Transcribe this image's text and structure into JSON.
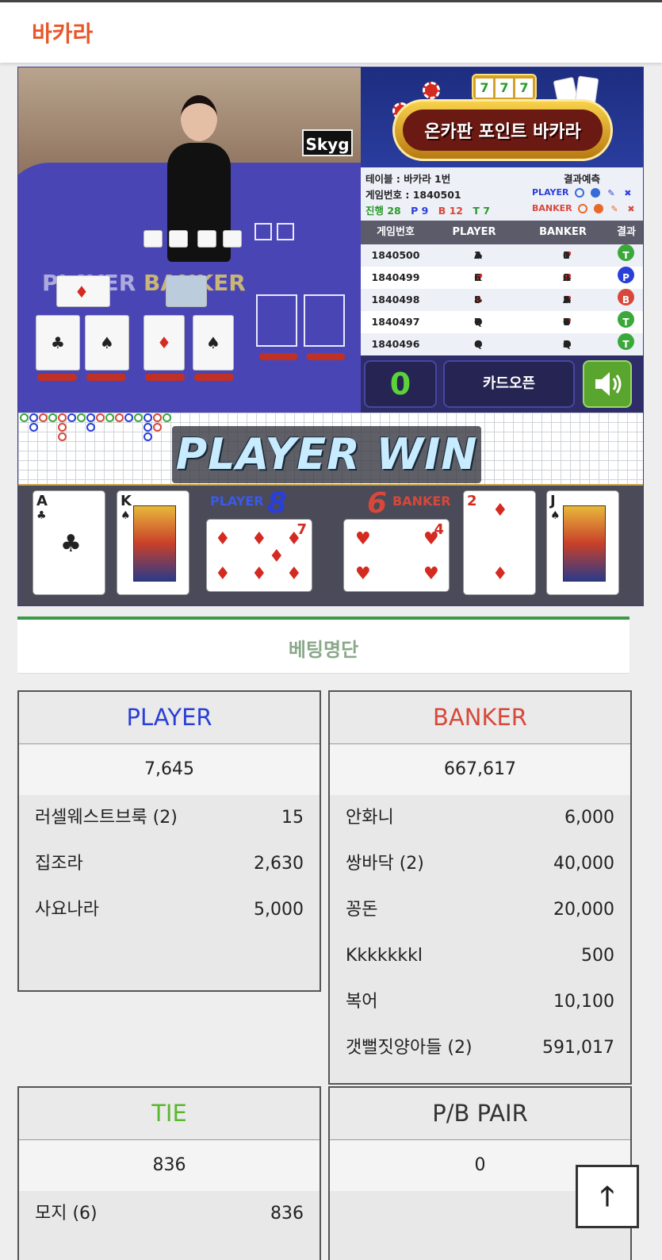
{
  "header": {
    "title": "바카라"
  },
  "game": {
    "video": {
      "felt_player": "PLAYER",
      "felt_banker": "BANKER",
      "sign": "Skyg"
    },
    "banner": {
      "title": "온카판 포인트 바카라",
      "reels": [
        "7",
        "7",
        "7"
      ]
    },
    "info": {
      "table": "테이블 : 바카라 1번",
      "game_no": "게임번호 : 1840501",
      "progress_label": "진행 28",
      "p_count": "P 9",
      "b_count": "B 12",
      "t_count": "T 7",
      "predict_title": "결과예측",
      "predict_player": "PLAYER",
      "predict_banker": "BANKER"
    },
    "history": {
      "headers": [
        "게임번호",
        "PLAYER",
        "BANKER",
        "결과"
      ],
      "rows": [
        {
          "no": "1840500",
          "player": "♣3♣A♠A",
          "banker": "♥5♥10",
          "result": "T"
        },
        {
          "no": "1840499",
          "player": "♥2♦K♥6",
          "banker": "♣10♣A♥9",
          "result": "P"
        },
        {
          "no": "1840498",
          "player": "♣5♦8♦8",
          "banker": "♥A♠A♣5",
          "result": "B"
        },
        {
          "no": "1840497",
          "player": "♦7♠Q",
          "banker": "♥7♠10",
          "result": "T"
        },
        {
          "no": "1840496",
          "player": "♠Q♣6",
          "banker": "♣Q♠3♣3",
          "result": "T"
        }
      ]
    },
    "controls": {
      "count": "0",
      "open_label": "카드오픈"
    },
    "result": {
      "win_text": "PLAYER WIN",
      "player_label": "PLAYER",
      "player_score": "8",
      "banker_label": "BANKER",
      "banker_score": "6",
      "player_cards": [
        {
          "rank": "A",
          "suit": "♣"
        },
        {
          "rank": "K",
          "suit": "♠"
        },
        {
          "rank": "7",
          "suit": "♦"
        }
      ],
      "banker_cards": [
        {
          "rank": "4",
          "suit": "♥"
        },
        {
          "rank": "2",
          "suit": "♦"
        },
        {
          "rank": "J",
          "suit": "♠"
        }
      ]
    }
  },
  "betting": {
    "title": "베팅명단",
    "player": {
      "label": "PLAYER",
      "total": "7,645",
      "rows": [
        {
          "name": "러셀웨스트브룩 (2)",
          "amount": "15"
        },
        {
          "name": "집조라",
          "amount": "2,630"
        },
        {
          "name": "사요나라",
          "amount": "5,000"
        }
      ]
    },
    "banker": {
      "label": "BANKER",
      "total": "667,617",
      "rows": [
        {
          "name": "안화니",
          "amount": "6,000"
        },
        {
          "name": "쌍바닥 (2)",
          "amount": "40,000"
        },
        {
          "name": "꽁돈",
          "amount": "20,000"
        },
        {
          "name": "Kkkkkkkl",
          "amount": "500"
        },
        {
          "name": "복어",
          "amount": "10,100"
        },
        {
          "name": "갯뻘짓양아들 (2)",
          "amount": "591,017"
        }
      ]
    },
    "tie": {
      "label": "TIE",
      "total": "836",
      "rows": [
        {
          "name": "모지 (6)",
          "amount": "836"
        }
      ]
    },
    "pair": {
      "label": "P/B PAIR",
      "total": "0"
    }
  },
  "colors": {
    "accent": "#e8572a",
    "player": "#2a3fd8",
    "banker": "#d8483a",
    "tie": "#5ab82e",
    "list_border": "#3a9a48"
  },
  "icons": {
    "sound": "speaker-icon",
    "scroll_top": "arrow-up-icon"
  }
}
